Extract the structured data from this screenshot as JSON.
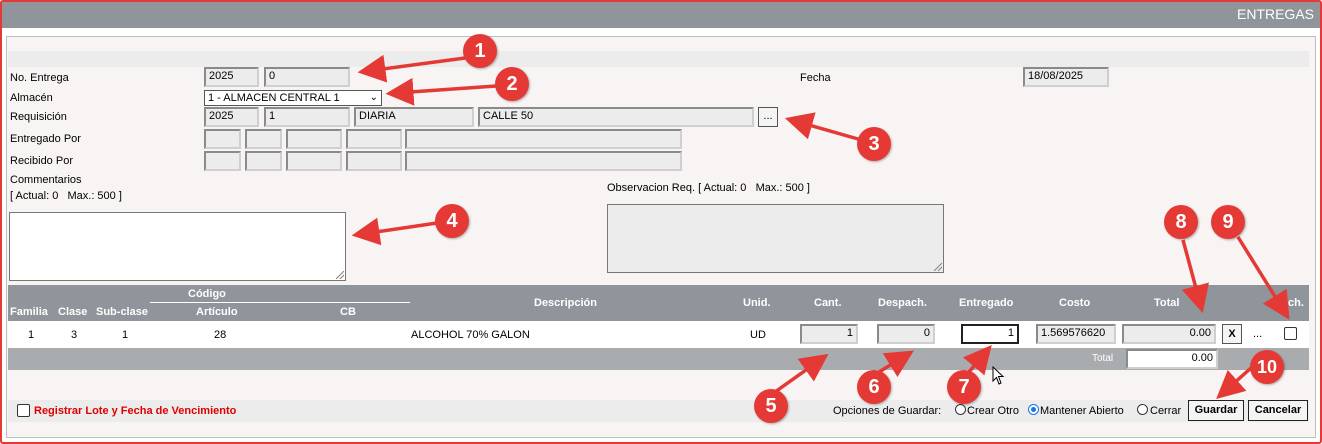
{
  "window": {
    "title": "ENTREGAS"
  },
  "form": {
    "no_entrega": {
      "label": "No. Entrega",
      "year": "2025",
      "number": "0"
    },
    "fecha": {
      "label": "Fecha",
      "value": "18/08/2025"
    },
    "almacen": {
      "label": "Almacén",
      "selected": "1 - ALMACEN CENTRAL 1"
    },
    "requisicion": {
      "label": "Requisición",
      "year": "2025",
      "number": "1",
      "type": "DIARIA",
      "location": "CALLE 50",
      "browse_label": "..."
    },
    "entregado_por": {
      "label": "Entregado Por"
    },
    "recibido_por": {
      "label": "Recibido Por"
    },
    "comentarios": {
      "label": "Commentarios",
      "counter": "[ Actual: 0   Max.: 500 ]"
    },
    "observacion": {
      "label": "Observacion Req. [ Actual: 0   Max.: 500 ]"
    }
  },
  "grid": {
    "headers": {
      "codigo": "Código",
      "familia": "Familia",
      "clase": "Clase",
      "subclase": "Sub-clase",
      "articulo": "Artículo",
      "cb": "CB",
      "descripcion": "Descripción",
      "unid": "Unid.",
      "cant": "Cant.",
      "despach": "Despach.",
      "entregado": "Entregado",
      "costo": "Costo",
      "total": "Total",
      "rech": "Rech."
    },
    "row": {
      "familia": "1",
      "clase": "3",
      "subclase": "1",
      "articulo": "28",
      "descripcion": "ALCOHOL 70% GALON",
      "unid": "UD",
      "cant": "1",
      "despach": "0",
      "entregado": "1",
      "costo": "1.569576620",
      "total": "0.00",
      "remove_label": "X",
      "more_label": "..."
    },
    "footer": {
      "total_label": "Total",
      "total_value": "0.00"
    }
  },
  "bottom": {
    "lote_label": "Registrar Lote y Fecha de Vencimiento",
    "opciones_label": "Opciones de Guardar:",
    "options": [
      "Crear Otro",
      "Mantener Abierto",
      "Cerrar"
    ],
    "selected_option": "Mantener Abierto",
    "save_label": "Guardar",
    "cancel_label": "Cancelar"
  },
  "annotations": [
    "1",
    "2",
    "3",
    "4",
    "5",
    "6",
    "7",
    "8",
    "9",
    "10"
  ],
  "colors": {
    "annotation_red": "#e53935",
    "header_gray": "#8f959a",
    "radio_blue": "#1a73e8",
    "lote_red": "#e00000"
  }
}
